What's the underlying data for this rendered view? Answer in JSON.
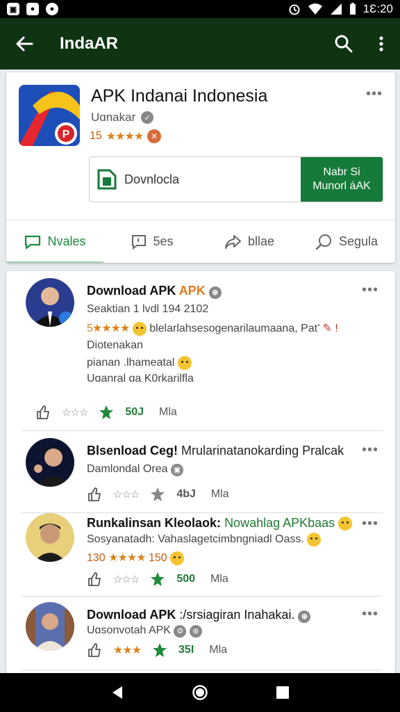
{
  "status_bar": {
    "time": "1Ɛ:20"
  },
  "app_bar": {
    "title": "IndaAR"
  },
  "app": {
    "name": "APK Indanai Indonesia",
    "developer": "Uɑnakar",
    "rating_num": "15",
    "rating_stars": "★★★★",
    "download_label": "Dovnlocla",
    "cta_line1": "Nabr Si",
    "cta_line2": "Munorl ȧAK"
  },
  "tabs": [
    {
      "label": "Nvales",
      "icon": "chat-icon"
    },
    {
      "label": "5es",
      "icon": "comment-icon"
    },
    {
      "label": "bllae",
      "icon": "share-icon"
    },
    {
      "label": "Segula",
      "icon": "search-icon"
    }
  ],
  "posts": [
    {
      "name": "Download APK",
      "name_accent": "APK",
      "subtitle": "Seaktian 1 lvdl 194 2102",
      "rating_stars": "5★★★★",
      "text_1": "blelarlahsesogenarilaumaana, Pat’",
      "text_2": "Diotenakan",
      "text_3": "pianan .lhameatal",
      "text_4": "Uɑanral ɑa K0rkarilfla",
      "count": "50J",
      "more": "Mla"
    },
    {
      "name": "Blsenload Ceg!",
      "name_rest": "Mrularinatanokarding Pralcak",
      "subtitle": "Damlondal Orea",
      "count": "4bJ",
      "more": "Mla"
    },
    {
      "name": "Runkalinsan Kleolaok:",
      "name_rest": "Nowahlag APKbaas",
      "subtitle": "Sosyanatadh: Vahaslagetcimbngniadl Oass.",
      "rating_num": "130",
      "rating_stars": "★★★★",
      "rating_tail": "150",
      "count": "500",
      "more": "Mla"
    },
    {
      "name": "Download APK",
      "name_rest": ":/srsiagiran Inahakai.",
      "subtitle": "Uɑsonvotah APK",
      "rating_stars": "★★★",
      "count": "35I",
      "more": "Mla"
    }
  ],
  "colors": {
    "app_bar": "#0f3313",
    "accent_green": "#167a3a",
    "star_orange": "#d9841c"
  }
}
